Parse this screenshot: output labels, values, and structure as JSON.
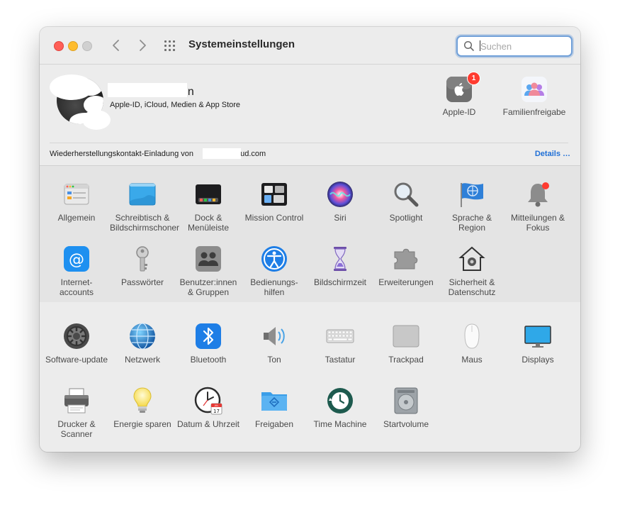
{
  "window": {
    "title": "Systemeinstellungen"
  },
  "search": {
    "placeholder": "Suchen"
  },
  "account": {
    "name_suffix": "nn",
    "subtitle": "Apple-ID, iCloud, Medien & App Store"
  },
  "top_items": [
    {
      "label": "Apple-ID",
      "badge": "1"
    },
    {
      "label": "Familienfreigabe"
    }
  ],
  "notice": {
    "text_prefix": "Wiederherstellungskontakt-Einladung von",
    "text_suffix": "cloud.com",
    "link": "Details …"
  },
  "panes_row1": [
    {
      "label": "Allgemein",
      "icon": "general-icon"
    },
    {
      "label": "Schreibtisch & Bildschirmschoner",
      "icon": "desktop-icon"
    },
    {
      "label": "Dock & Menüleiste",
      "icon": "dock-icon"
    },
    {
      "label": "Mission Control",
      "icon": "mission-control-icon"
    },
    {
      "label": "Siri",
      "icon": "siri-icon"
    },
    {
      "label": "Spotlight",
      "icon": "spotlight-icon"
    },
    {
      "label": "Sprache & Region",
      "icon": "language-region-icon"
    },
    {
      "label": "Mitteilungen & Fokus",
      "icon": "notifications-icon"
    }
  ],
  "panes_row2": [
    {
      "label": "Internet-accounts",
      "icon": "internet-accounts-icon"
    },
    {
      "label": "Passwörter",
      "icon": "passwords-icon"
    },
    {
      "label": "Benutzer:innen & Gruppen",
      "icon": "users-groups-icon"
    },
    {
      "label": "Bedienungs-hilfen",
      "icon": "accessibility-icon"
    },
    {
      "label": "Bildschirmzeit",
      "icon": "screen-time-icon"
    },
    {
      "label": "Erweiterungen",
      "icon": "extensions-icon"
    },
    {
      "label": "Sicherheit & Datenschutz",
      "icon": "security-icon"
    }
  ],
  "panes_row3": [
    {
      "label": "Software-update",
      "icon": "software-update-icon"
    },
    {
      "label": "Netzwerk",
      "icon": "network-icon"
    },
    {
      "label": "Bluetooth",
      "icon": "bluetooth-icon"
    },
    {
      "label": "Ton",
      "icon": "sound-icon"
    },
    {
      "label": "Tastatur",
      "icon": "keyboard-icon"
    },
    {
      "label": "Trackpad",
      "icon": "trackpad-icon"
    },
    {
      "label": "Maus",
      "icon": "mouse-icon"
    },
    {
      "label": "Displays",
      "icon": "displays-icon"
    }
  ],
  "panes_row4": [
    {
      "label": "Drucker & Scanner",
      "icon": "printer-icon"
    },
    {
      "label": "Energie sparen",
      "icon": "energy-icon"
    },
    {
      "label": "Datum & Uhrzeit",
      "icon": "date-time-icon",
      "calendar_month": "JUL",
      "calendar_day": "17"
    },
    {
      "label": "Freigaben",
      "icon": "sharing-icon"
    },
    {
      "label": "Time Machine",
      "icon": "time-machine-icon"
    },
    {
      "label": "Startvolume",
      "icon": "startup-disk-icon"
    }
  ],
  "colors": {
    "accent": "#1f6fd6",
    "badge": "#ff3b30",
    "close": "#ff5f57",
    "minimize": "#febc2e"
  }
}
